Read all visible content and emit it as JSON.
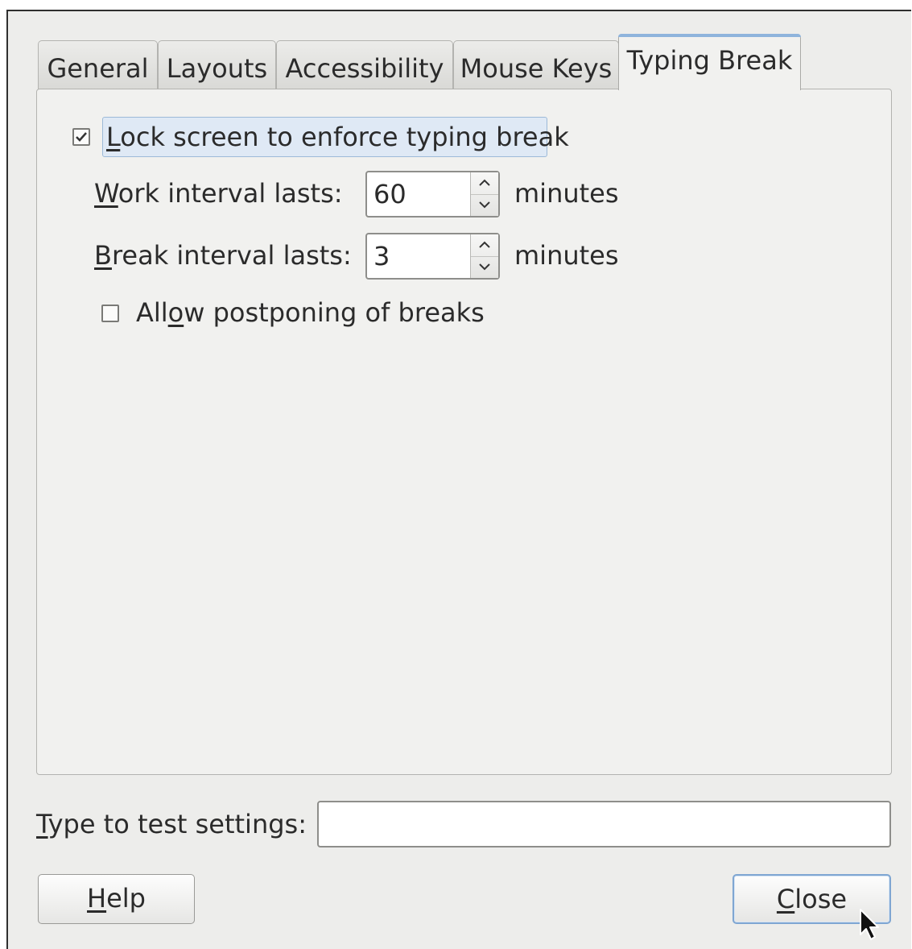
{
  "tabs": [
    {
      "label": "General"
    },
    {
      "label": "Layouts"
    },
    {
      "label": "Accessibility"
    },
    {
      "label": "Mouse Keys"
    },
    {
      "label": "Typing Break"
    }
  ],
  "active_tab": "Typing Break",
  "typing_break": {
    "lock_screen": {
      "mnemonic": "L",
      "rest": "ock screen to enforce typing break",
      "checked": true
    },
    "work_interval": {
      "mnemonic": "W",
      "rest": "ork interval lasts:",
      "value": "60",
      "unit": "minutes"
    },
    "break_interval": {
      "mnemonic": "B",
      "rest": "reak interval lasts:",
      "value": "3",
      "unit": "minutes"
    },
    "allow_postpone": {
      "pre": "All",
      "mnemonic": "o",
      "rest": "w postponing of breaks",
      "checked": false
    }
  },
  "test": {
    "mnemonic": "T",
    "rest": "ype to test settings:",
    "value": ""
  },
  "buttons": {
    "help": {
      "mnemonic": "H",
      "rest": "elp"
    },
    "close": {
      "mnemonic": "C",
      "rest": "lose"
    }
  },
  "icons": {
    "checkmark": "check-icon",
    "spin_up": "chevron-up-icon",
    "spin_down": "chevron-down-icon",
    "pointer": "mouse-pointer-icon"
  },
  "colors": {
    "window_bg": "#ededeb",
    "focus": "#8fb4dc"
  }
}
